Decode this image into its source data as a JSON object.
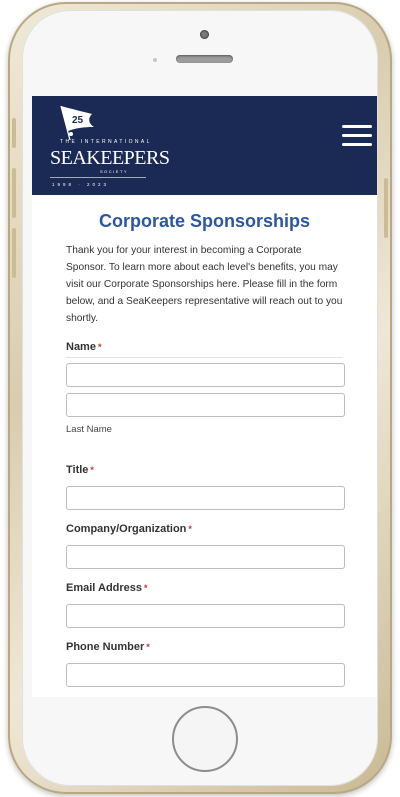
{
  "site": {
    "logo": {
      "anniversary": "25",
      "international": "THE INTERNATIONAL",
      "name": "SEAKEEPERS",
      "society": "SOCIETY",
      "years": "1998 · 2023"
    }
  },
  "page": {
    "title": "Corporate Sponsorships",
    "intro_before_link": "Thank you for your interest in becoming a Corporate Sponsor. To learn more about each level's benefits, you may visit our Corporate Sponsorships ",
    "intro_link": "here",
    "intro_after_link": ". Please fill in the form below, and a SeaKeepers representative will reach out to you shortly."
  },
  "form": {
    "required_marker": "*",
    "name": {
      "label": "Name",
      "first_value": "",
      "last_value": "",
      "last_sublabel": "Last Name"
    },
    "title": {
      "label": "Title",
      "value": ""
    },
    "company": {
      "label": "Company/Organization",
      "value": ""
    },
    "email": {
      "label": "Email Address",
      "value": ""
    },
    "phone": {
      "label": "Phone Number",
      "value": ""
    }
  },
  "colors": {
    "header_bg": "#1b2a54",
    "title": "#2c579a",
    "required": "#c0392b",
    "phone_frame": "#d9ccaf"
  },
  "icons": {
    "menu": "hamburger-menu-icon",
    "logo_flag": "flag-icon"
  }
}
